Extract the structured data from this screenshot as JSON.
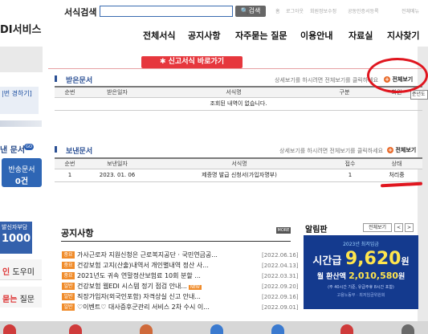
{
  "header": {
    "brand": "DI서비스",
    "search_label": "서식검색",
    "search_value": "",
    "search_button": "검색",
    "util_links": [
      "홈",
      "로그아웃",
      "회원정보수정",
      "공동인증서등록",
      "전체메뉴"
    ]
  },
  "nav": [
    "전체서식",
    "공지사항",
    "자주묻는 질문",
    "이용안내",
    "자료실",
    "지사찾기"
  ],
  "left": {
    "account_label": "|번 경하기]",
    "doc_label": "낸 문서",
    "go_badge": "GO",
    "banner_line1": "반송문서",
    "banner_line2": "0건",
    "bottom_small": "발신자부담",
    "bottom_big": "1000",
    "help1_prefix": "인",
    "help1_suffix": "도우미",
    "help2_prefix": "묻는",
    "help2_suffix": "질문"
  },
  "shortcut_tab": "신고서식 바로가기",
  "received": {
    "title": "받은문서",
    "hint": "상세보기를 하시려면 전체보기를 클릭하세요",
    "more": "전체보기",
    "columns": [
      "순번",
      "받은일자",
      "서식명",
      "구분",
      "회원"
    ],
    "empty_message": "조회된 내역이 없습니다.",
    "tooltip": "준년도"
  },
  "sent": {
    "title": "보낸문서",
    "hint": "상세보기를 하시려면 전체보기를 클릭하세요",
    "more": "전체보기",
    "columns": [
      "순번",
      "보낸일자",
      "서식명",
      "접수",
      "상태"
    ],
    "rows": [
      {
        "no": "1",
        "date": "2023. 01. 06",
        "form": "제증명 발급 신청서(가입자명부)",
        "receipt": "1",
        "status": "처리중"
      }
    ]
  },
  "notice": {
    "title": "공지사항",
    "more_badge": "MORE",
    "items": [
      {
        "tag": "중요",
        "text": "가사근로자 지원신청은 근로복지공단 · 국민연금공...",
        "date": "[2022.06.16]",
        "new": ""
      },
      {
        "tag": "중요",
        "text": "건강보험 고지(산출)내역서 개인별내역 정산 사...",
        "date": "[2022.04.13]",
        "new": ""
      },
      {
        "tag": "중요",
        "text": "2021년도 귀속 연말정산보험료 10회 분할 ...",
        "date": "[2022.03.31]",
        "new": ""
      },
      {
        "tag": "일반",
        "text": "건강보험 웹EDI 시스템 정기 점검 안내...",
        "date": "[2022.09.20]",
        "new": "NEW"
      },
      {
        "tag": "일반",
        "text": "직장가입자(외국인포함) 자격상실 신고 안내...",
        "date": "[2022.09.16]",
        "new": ""
      },
      {
        "tag": "일반",
        "text": "♡이벤트♡ 대사증후군관리 서비스 2차 수시 이...",
        "date": "[2022.09.01]",
        "new": ""
      }
    ]
  },
  "board": {
    "title": "알림판",
    "all_button": "전체보기",
    "prev": "<",
    "next": ">",
    "wage_caption": "2023년 최저임금",
    "wage_prefix": "시간급",
    "wage_amount": "9,620",
    "wage_unit": "원",
    "monthly_prefix": "월 환산액",
    "monthly_amount": "2,010,580",
    "monthly_unit": "원",
    "note": "(주 40시간 기준, 유급주휴 8시간 포함)",
    "org": "고용노동부 · 최저임금위원회"
  },
  "colors": {
    "accent_red": "#e6373d",
    "brand_blue": "#2a4f94",
    "annotation_red": "#e0161f",
    "tag_orange": "#f08c2b"
  }
}
